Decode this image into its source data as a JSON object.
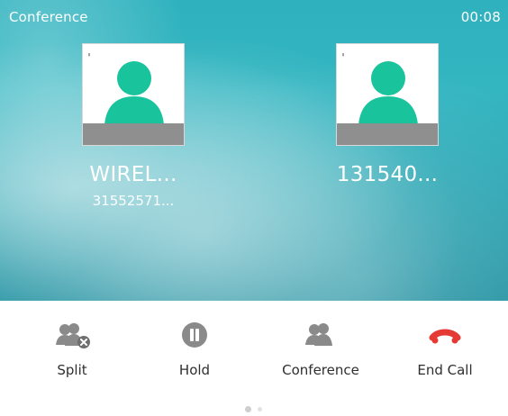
{
  "status_bar": {
    "title": "Conference",
    "timer": "00:08"
  },
  "participants": [
    {
      "name": "WIREL...",
      "number": "31552571...",
      "avatar_icon": "person-icon",
      "status_icon": "lock-icon"
    },
    {
      "name": "131540...",
      "number": "",
      "avatar_icon": "person-icon",
      "status_icon": "lock-icon"
    }
  ],
  "controls": {
    "split": {
      "label": "Split",
      "icon": "split-icon"
    },
    "hold": {
      "label": "Hold",
      "icon": "pause-icon"
    },
    "conference": {
      "label": "Conference",
      "icon": "conference-icon"
    },
    "end_call": {
      "label": "End Call",
      "icon": "end-call-icon"
    }
  },
  "pager": {
    "current": 1,
    "total": 2
  },
  "colors": {
    "avatar_green": "#19c39c",
    "icon_gray": "#8a8a8a",
    "end_call_red": "#e53935",
    "avatar_bar_gray": "#8f8f8f"
  }
}
